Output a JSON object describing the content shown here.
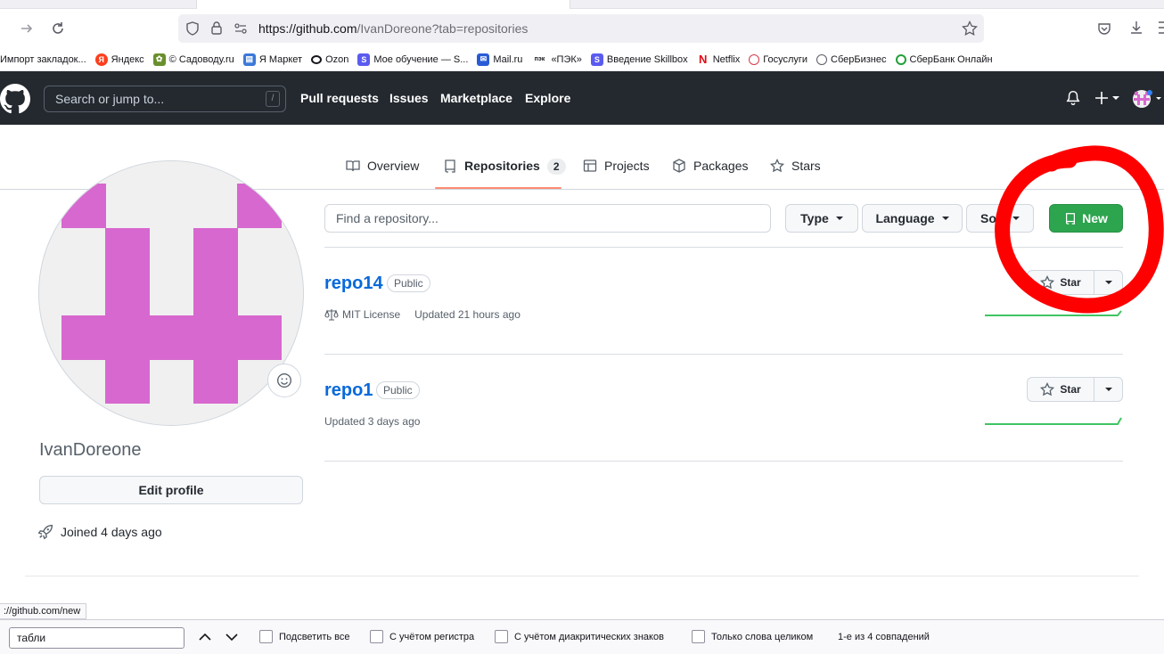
{
  "browser": {
    "url_host": "https://github.com",
    "url_path": "/IvanDoreone?tab=repositories",
    "status_url": "://github.com/new",
    "bookmarks": [
      {
        "label": "Импорт закладок...",
        "icon": "folder-icon",
        "color": "#6c6c75"
      },
      {
        "label": "Яндекс",
        "icon": "yandex-icon",
        "color": "#fc3f1d"
      },
      {
        "label": "© Садоводу.ru",
        "icon": "sadovodu-icon",
        "color": "#6a8f2d"
      },
      {
        "label": "Я Маркет",
        "icon": "market-icon",
        "color": "#3c78d8"
      },
      {
        "label": "Ozon",
        "icon": "ozon-icon",
        "color": "#15141a"
      },
      {
        "label": "Мое обучение — S...",
        "icon": "skillbox-icon",
        "color": "#5b5bf0"
      },
      {
        "label": "Mail.ru",
        "icon": "mail-icon",
        "color": "#2a5bd7"
      },
      {
        "label": "«ПЭК»",
        "icon": "pek-icon",
        "color": "#15141a"
      },
      {
        "label": "Введение Skillbox",
        "icon": "skillbox-icon",
        "color": "#5b5bf0"
      },
      {
        "label": "Netflix",
        "icon": "netflix-icon",
        "color": "#e50914"
      },
      {
        "label": "Госуслуги",
        "icon": "gosuslugi-icon",
        "color": "#d73a49"
      },
      {
        "label": "СберБизнес",
        "icon": "globe-icon",
        "color": "#6c6c75"
      },
      {
        "label": "СберБанк Онлайн",
        "icon": "sber-icon",
        "color": "#21a038"
      }
    ]
  },
  "header": {
    "search_placeholder": "Search or jump to...",
    "slash_key": "/",
    "nav": [
      "Pull requests",
      "Issues",
      "Marketplace",
      "Explore"
    ]
  },
  "tabs": {
    "overview": "Overview",
    "repositories": "Repositories",
    "repositories_count": "2",
    "projects": "Projects",
    "packages": "Packages",
    "stars": "Stars"
  },
  "profile": {
    "username": "IvanDoreone",
    "edit_label": "Edit profile",
    "joined": "Joined 4 days ago",
    "avatar_color": "#d768cf"
  },
  "filters": {
    "search_placeholder": "Find a repository...",
    "type": "Type",
    "language": "Language",
    "sort": "Sort",
    "new_label": "New",
    "new_color": "#2da44e"
  },
  "repos": [
    {
      "name": "repo14",
      "visibility": "Public",
      "license": "MIT License",
      "updated": "Updated 21 hours ago",
      "star_label": "Star"
    },
    {
      "name": "repo1",
      "visibility": "Public",
      "license": "",
      "updated": "Updated 3 days ago",
      "star_label": "Star"
    }
  ],
  "find_bar": {
    "query": "табли",
    "highlight_all": "Подсветить все",
    "match_case": "С учётом регистра",
    "match_diacritics": "С учётом диакритических знаков",
    "whole_words": "Только слова целиком",
    "status": "1-е из 4 совпадений"
  },
  "annotation": {
    "color": "#ff0000"
  }
}
